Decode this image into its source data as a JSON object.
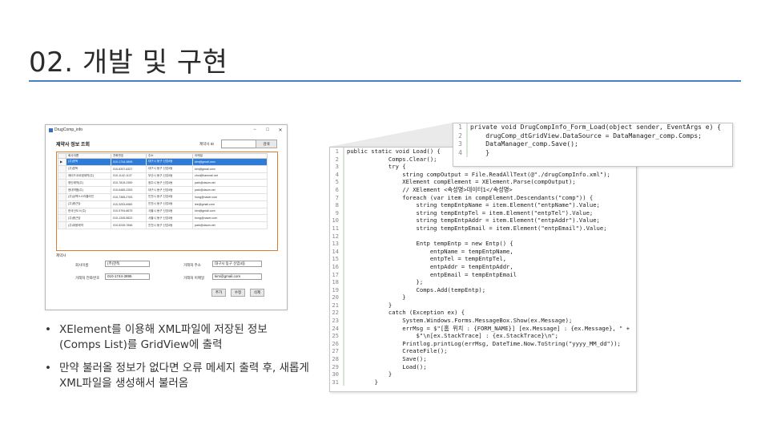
{
  "slide": {
    "title": "02. 개발 및 구현",
    "bullets": [
      "XElement를 이용해 XML파일에 저장된 정보 (Comps List)를 GridView에 출력",
      "만약 불러올 정보가 없다면 오류 메세지 출력 후, 새롭게 XML파일을 생성해서 불러옴"
    ]
  },
  "app": {
    "window_title": "DrugComp_info",
    "controls": {
      "minimize": "−",
      "maximize": "□",
      "close": "✕"
    },
    "header": "제약사 정보 조회",
    "search_label": "제약사 ID",
    "search_button": "검색",
    "grid": {
      "columns": [
        "회사이름",
        "전화번호",
        "주소",
        "이메일"
      ],
      "rows": [
        {
          "marker": "▶",
          "cells": [
            "(주)한독",
            "010-1744-3895",
            "대구시 동구 신암4동",
            "kim@gmail.com"
          ]
        },
        {
          "marker": "",
          "cells": [
            "(주)한독",
            "010-6337-6327",
            "대구시 동구 신암4동",
            "kim@gmail.com"
          ]
        },
        {
          "marker": "",
          "cells": [
            "제이드코르엠제약(주)",
            "010-1142-1137",
            "부산시 동구 신암4동",
            "choi@hanmail.net"
          ]
        },
        {
          "marker": "",
          "cells": [
            "명인제약(주)",
            "010-7819-2390",
            "광주시 동구 신암4동",
            "park@daum.net"
          ]
        },
        {
          "marker": "",
          "cells": [
            "현대약품(주)",
            "010-6485-2263",
            "대구시 동구 신암4동",
            "park@daum.net"
          ]
        },
        {
          "marker": "",
          "cells": [
            "(주)삼백스스라졸라인",
            "010-7365-2763",
            "인천시 동구 신암4동",
            "hong@naver.com"
          ]
        },
        {
          "marker": "",
          "cells": [
            "(주)종근당",
            "010-3253-6982",
            "인천시 동구 신암4동",
            "lee@gmail.com"
          ]
        },
        {
          "marker": "",
          "cells": [
            "한국산도스(주)",
            "010-9794-8675",
            "서울시 동구 신암4동",
            "kim@gmail.com"
          ]
        },
        {
          "marker": "",
          "cells": [
            "(주)종근당",
            "010-1345-5623",
            "서울시 동구 신암4동",
            "hong@naver.com"
          ]
        },
        {
          "marker": "",
          "cells": [
            "(주)대웅제약",
            "010-5249-7846",
            "인천시 동구 신암4동",
            "park@daum.net"
          ]
        }
      ]
    },
    "detail": {
      "section_label": "제약사",
      "company_label": "회사이름",
      "company_value": "(주)한독",
      "address_label": "거래처 주소",
      "address_value": "대구시 동구 신암4동",
      "phone_label": "거래처 전화번호",
      "phone_value": "010-1744-3895",
      "email_label": "거래처 이메일",
      "email_value": "kim@gmail.com",
      "buttons": {
        "add": "추가",
        "edit": "수정",
        "delete": "삭제"
      }
    }
  },
  "code_main": {
    "lines": [
      {
        "n": "1",
        "t": "public static void Load() {"
      },
      {
        "n": "2",
        "t": "            Comps.Clear();"
      },
      {
        "n": "3",
        "t": "            try {"
      },
      {
        "n": "4",
        "t": "                string compOutput = File.ReadAllText(@\"./drugCompInfo.xml\");"
      },
      {
        "n": "5",
        "t": "                XElement compElement = XElement.Parse(compOutput);"
      },
      {
        "n": "6",
        "t": "                // XElement <속성명>데이터1</속성명>"
      },
      {
        "n": "7",
        "t": "                foreach (var item in compElement.Descendants(\"comp\")) {"
      },
      {
        "n": "8",
        "t": "                    string tempEntpName = item.Element(\"entpName\").Value;"
      },
      {
        "n": "9",
        "t": "                    string tempEntpTel = item.Element(\"entpTel\").Value;"
      },
      {
        "n": "10",
        "t": "                    string tempEntpAddr = item.Element(\"entpAddr\").Value;"
      },
      {
        "n": "11",
        "t": "                    string tempEntpEmail = item.Element(\"entpEmail\").Value;"
      },
      {
        "n": "12",
        "t": ""
      },
      {
        "n": "13",
        "t": "                    Entp tempEntp = new Entp() {"
      },
      {
        "n": "14",
        "t": "                        entpName = tempEntpName,"
      },
      {
        "n": "15",
        "t": "                        entpTel = tempEntpTel,"
      },
      {
        "n": "16",
        "t": "                        entpAddr = tempEntpAddr,"
      },
      {
        "n": "17",
        "t": "                        entpEmail = tempEntpEmail"
      },
      {
        "n": "18",
        "t": "                    };"
      },
      {
        "n": "19",
        "t": "                    Comps.Add(tempEntp);"
      },
      {
        "n": "20",
        "t": "                }"
      },
      {
        "n": "21",
        "t": "            }"
      },
      {
        "n": "22",
        "t": "            catch (Exception ex) {"
      },
      {
        "n": "23",
        "t": "                System.Windows.Forms.MessageBox.Show(ex.Message);"
      },
      {
        "n": "24",
        "t": "                errMsg = $\"[홈 위치 : {FORM_NAME}] [ex.Message] : {ex.Message}, \" +"
      },
      {
        "n": "25",
        "t": "                    $\"\\n[ex.StackTrace] : {ex.StackTrace}\\n\";"
      },
      {
        "n": "26",
        "t": "                Printlog.printLog(errMsg, DateTime.Now.ToString(\"yyyy_MM_dd\"));"
      },
      {
        "n": "27",
        "t": "                CreateFile();"
      },
      {
        "n": "28",
        "t": "                Save();"
      },
      {
        "n": "29",
        "t": "                Load();"
      },
      {
        "n": "30",
        "t": "            }"
      },
      {
        "n": "31",
        "t": "        }"
      }
    ]
  },
  "code_small": {
    "lines": [
      {
        "n": "1",
        "t": "private void DrugCompInfo_Form_Load(object sender, EventArgs e) {"
      },
      {
        "n": "2",
        "t": "    drugComp_dtGridView.DataSource = DataManager_comp.Comps;"
      },
      {
        "n": "3",
        "t": "    DataManager_comp.Save();"
      },
      {
        "n": "4",
        "t": "    }"
      }
    ]
  },
  "colors": {
    "title_rule": "#4a7fc9",
    "grid_highlight": "#e07c2a",
    "row_selected": "#2f7bd6"
  }
}
